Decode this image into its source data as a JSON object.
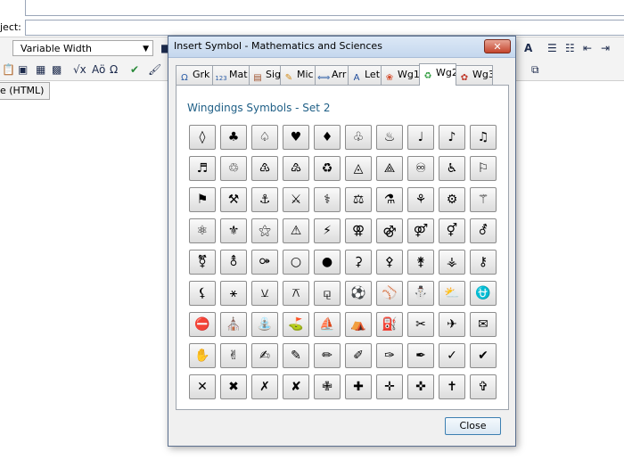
{
  "editor": {
    "subject_label": "ject:",
    "font_select": "Variable Width",
    "tab_label": "e (HTML)",
    "toolbar_row2_text": [
      "√x",
      "Aö",
      "Ω"
    ],
    "toolbar_row1_right": "A"
  },
  "dialog": {
    "title": "Insert Symbol - Mathematics and Sciences",
    "close_x": "✕",
    "section_title": "Wingdings Symbols - Set 2",
    "close_button": "Close",
    "tabs": [
      {
        "label": "Grk",
        "icon": "omega-icon",
        "glyph": "Ω",
        "color": "#2d5ea7"
      },
      {
        "label": "Mat",
        "icon": "numbers-icon",
        "glyph": "123",
        "color": "#2d5ea7"
      },
      {
        "label": "Sig",
        "icon": "ruler-icon",
        "glyph": "▤",
        "color": "#a0522d"
      },
      {
        "label": "Mic",
        "icon": "pencil-icon",
        "glyph": "✎",
        "color": "#d28a17"
      },
      {
        "label": "Arr",
        "icon": "arrow-icon",
        "glyph": "⟺",
        "color": "#2d5ea7"
      },
      {
        "label": "Let",
        "icon": "letter-a-icon",
        "glyph": "A",
        "color": "#1c4a9a"
      },
      {
        "label": "Wg1",
        "icon": "flower-icon",
        "glyph": "❀",
        "color": "#d44a2a"
      },
      {
        "label": "Wg2",
        "icon": "recycle-icon",
        "glyph": "♻",
        "color": "#2a9a3a"
      },
      {
        "label": "Wg3",
        "icon": "gear-icon",
        "glyph": "✿",
        "color": "#c0392b"
      }
    ],
    "active_tab": 7,
    "symbols": [
      [
        "◊",
        "♣",
        "♤",
        "♥",
        "♦",
        "♧",
        "♨",
        "♩",
        "♪",
        "♫"
      ],
      [
        "♬",
        "♲",
        "♳",
        "♴",
        "♻",
        "◬",
        "⟁",
        "♾",
        "♿",
        "⚐"
      ],
      [
        "⚑",
        "⚒",
        "⚓",
        "⚔",
        "⚕",
        "⚖",
        "⚗",
        "⚘",
        "⚙",
        "⚚"
      ],
      [
        "⚛",
        "⚜",
        "⚝",
        "⚠",
        "⚡",
        "⚢",
        "⚣",
        "⚤",
        "⚥",
        "⚦"
      ],
      [
        "⚧",
        "⚨",
        "⚩",
        "○",
        "●",
        "⚳",
        "⚴",
        "⚵",
        "⚶",
        "⚷"
      ],
      [
        "⚸",
        "⚹",
        "⚺",
        "⚻",
        "⚼",
        "⚽",
        "⚾",
        "⛄",
        "⛅",
        "⛎"
      ],
      [
        "⛔",
        "⛪",
        "⛲",
        "⛳",
        "⛵",
        "⛺",
        "⛽",
        "✂",
        "✈",
        "✉"
      ],
      [
        "✋",
        "✌",
        "✍",
        "✎",
        "✏",
        "✐",
        "✑",
        "✒",
        "✓",
        "✔"
      ],
      [
        "✕",
        "✖",
        "✗",
        "✘",
        "✙",
        "✚",
        "✛",
        "✜",
        "✝",
        "✞"
      ]
    ]
  }
}
